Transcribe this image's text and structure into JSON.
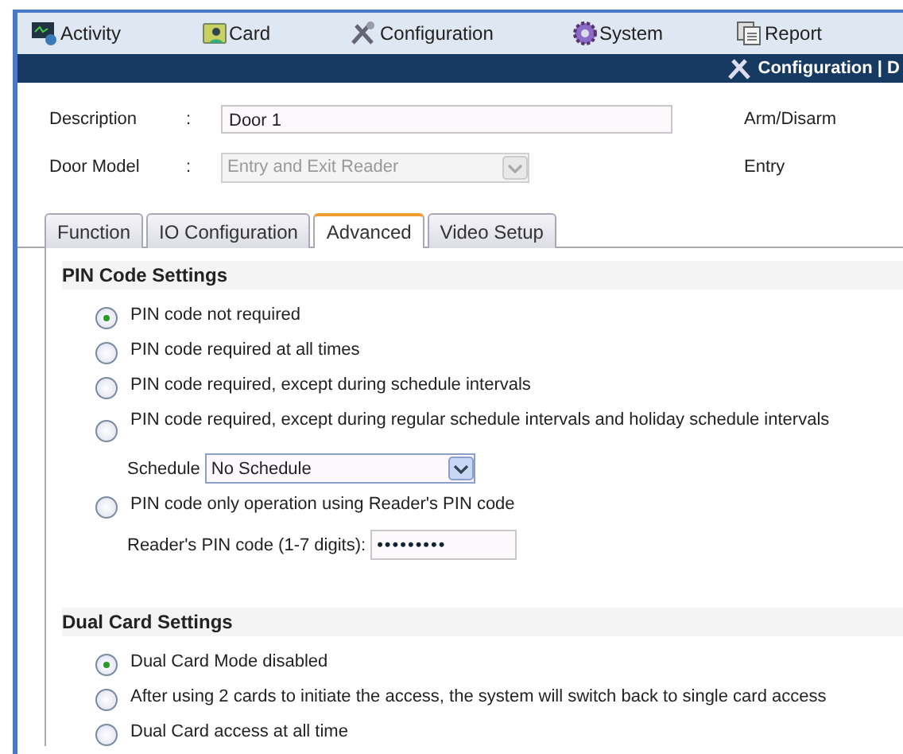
{
  "menu": [
    {
      "label": "Activity"
    },
    {
      "label": "Card"
    },
    {
      "label": "Configuration"
    },
    {
      "label": "System"
    },
    {
      "label": "Report"
    }
  ],
  "header": {
    "breadcrumb": "Configuration | D"
  },
  "form": {
    "rows": [
      {
        "label": "Description",
        "separator": ":",
        "kind": "text",
        "value": "Door 1",
        "disabled": false,
        "side": "Arm/Disarm"
      },
      {
        "label": "Door Model",
        "separator": ":",
        "kind": "select",
        "value": "Entry and Exit Reader",
        "disabled": true,
        "side": "Entry"
      }
    ]
  },
  "tabs": [
    {
      "label": "Function",
      "selected": false
    },
    {
      "label": "IO Configuration",
      "selected": false
    },
    {
      "label": "Advanced",
      "selected": true
    },
    {
      "label": "Video Setup",
      "selected": false
    }
  ],
  "sections": [
    {
      "title": "PIN Code Settings",
      "options": [
        {
          "label": "PIN code not required",
          "selected": true
        },
        {
          "label": "PIN code required at all times",
          "selected": false
        },
        {
          "label": "PIN code required, except during schedule intervals",
          "selected": false
        },
        {
          "label": "PIN code required, except during regular schedule intervals and holiday schedule intervals",
          "selected": false,
          "field": {
            "kind": "select",
            "label": "Schedule",
            "value": "No Schedule"
          }
        },
        {
          "label": "PIN code only operation using Reader's PIN code",
          "selected": false,
          "field": {
            "kind": "text",
            "label": "Reader's PIN code (1-7 digits):",
            "value": "•••••••••"
          }
        }
      ]
    },
    {
      "title": "Dual Card Settings",
      "options": [
        {
          "label": "Dual Card Mode disabled",
          "selected": true
        },
        {
          "label": "After using 2 cards to initiate the access, the system will switch back to single card access",
          "selected": false
        },
        {
          "label": "Dual Card access at all time",
          "selected": false
        }
      ]
    }
  ]
}
